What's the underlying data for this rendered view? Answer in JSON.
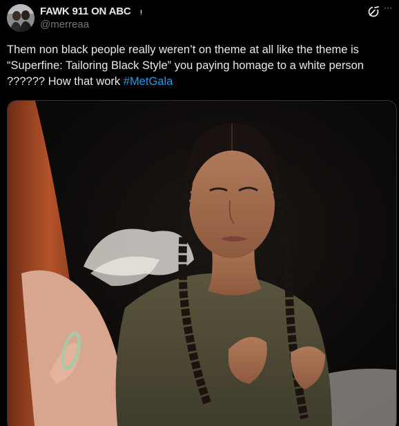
{
  "author": {
    "display_name": "FAWK 911 ON ABC",
    "name_glyph": "ᵎ",
    "handle": "@merreaa",
    "avatar_icon": "avatar-photo"
  },
  "header_icons": {
    "grok": "grok-icon",
    "more": "more-icon",
    "more_glyph": "···"
  },
  "tweet": {
    "text": "Them non black people really weren’t on theme at all like the theme is “Superfine: Tailoring Black Style” you paying homage to a white person ?????? How that work ",
    "hashtag": "#MetGala"
  },
  "media": {
    "type": "photo",
    "description_icon": "video-still"
  },
  "colors": {
    "background": "#000000",
    "text": "#e7e9ea",
    "secondary": "#71767b",
    "link": "#1d9bf0",
    "border": "#2f3336"
  }
}
